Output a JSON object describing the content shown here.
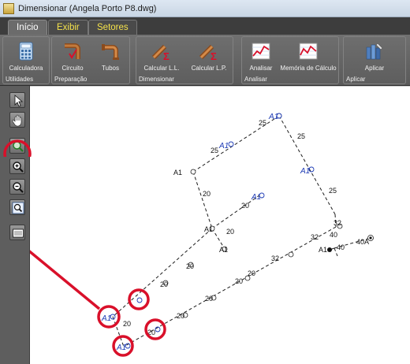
{
  "window": {
    "title": "Dimensionar (Angela Porto P8.dwg)"
  },
  "tabs": [
    {
      "label": "Início"
    },
    {
      "label": "Exibir"
    },
    {
      "label": "Setores"
    }
  ],
  "groups": {
    "utilidades": {
      "label": "Utilidades",
      "calculadora": "Calculadora"
    },
    "preparacao": {
      "label": "Preparação",
      "circuito": "Circuito",
      "tubos": "Tubos"
    },
    "dimensionar": {
      "label": "Dimensionar",
      "calcular_ll": "Calcular L.L.",
      "calcular_lp": "Calcular L.P."
    },
    "analisar": {
      "label": "Analisar",
      "analisar": "Analisar",
      "memoria": "Memória de Cálculo"
    },
    "aplicar": {
      "label": "Aplicar",
      "aplicar": "Aplicar"
    }
  },
  "colors": {
    "highlight": "#d9102a",
    "outlet_label": "#1d3bb5",
    "line": "#1c1c1c"
  },
  "drawing": {
    "dim_labels": [
      "25",
      "25",
      "25",
      "25",
      "20",
      "20",
      "20",
      "20",
      "20",
      "20",
      "20",
      "20",
      "20",
      "20",
      "20",
      "32",
      "32",
      "32",
      "40",
      "40",
      "40A"
    ],
    "node_labels": [
      "A1",
      "A1",
      "A1",
      "A1"
    ],
    "outlet_labels": [
      "A1",
      "A1",
      "A1",
      "A1",
      "A1",
      "A1"
    ]
  }
}
